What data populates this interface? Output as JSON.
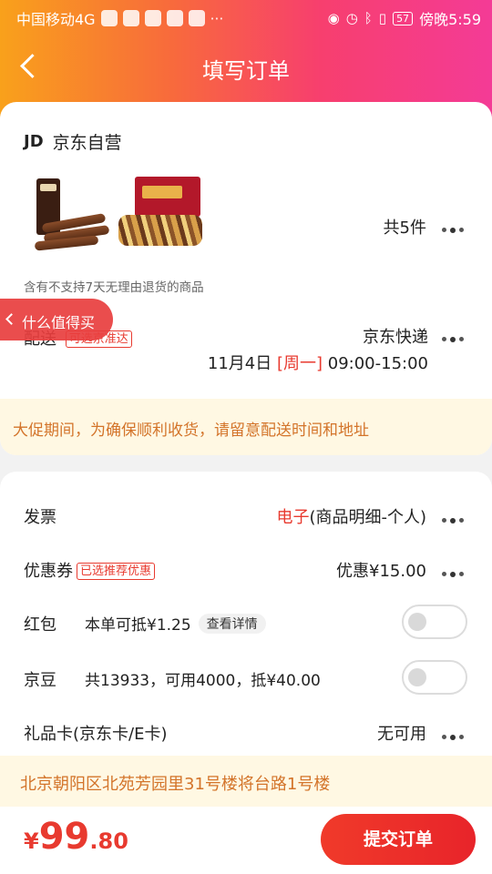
{
  "status_bar": {
    "carrier": "中国移动4G",
    "time": "傍晚5:59",
    "battery": "57"
  },
  "header": {
    "title": "填写订单"
  },
  "store": {
    "logo": "JD",
    "name": "京东自营"
  },
  "products": {
    "count": "共5件",
    "return_note": "含有不支持7天无理由退货的商品"
  },
  "delivery": {
    "label": "配送",
    "tag": "可选京准达",
    "method": "京东快递",
    "date": "11月4日",
    "weekday": "[周一]",
    "time_slot": "09:00-15:00"
  },
  "floating_tab": {
    "label": "什么值得买"
  },
  "promo_notice": "大促期间，为确保顺利收货，请留意配送时间和地址",
  "invoice": {
    "label": "发票",
    "type": "电子",
    "detail": "(商品明细-个人)"
  },
  "coupon": {
    "label": "优惠券",
    "tag": "已选推荐优惠",
    "value": "优惠¥15.00"
  },
  "red_packet": {
    "label": "红包",
    "text": "本单可抵¥1.25",
    "details_button": "查看详情",
    "enabled": false
  },
  "jd_beans": {
    "label": "京豆",
    "text": "共13933，可用4000，抵¥40.00",
    "enabled": false
  },
  "gift_card": {
    "label": "礼品卡(京东卡/E卡)",
    "value": "无可用"
  },
  "address": "北京朝阳区北苑芳园里31号楼将台路1号楼",
  "footer": {
    "currency": "¥",
    "price_integer": "99",
    "price_decimal": ".80",
    "submit_label": "提交订单"
  },
  "colors": {
    "accent_red": "#e83a2f",
    "notice_orange": "#d3742a",
    "notice_bg": "#fff8e3"
  }
}
